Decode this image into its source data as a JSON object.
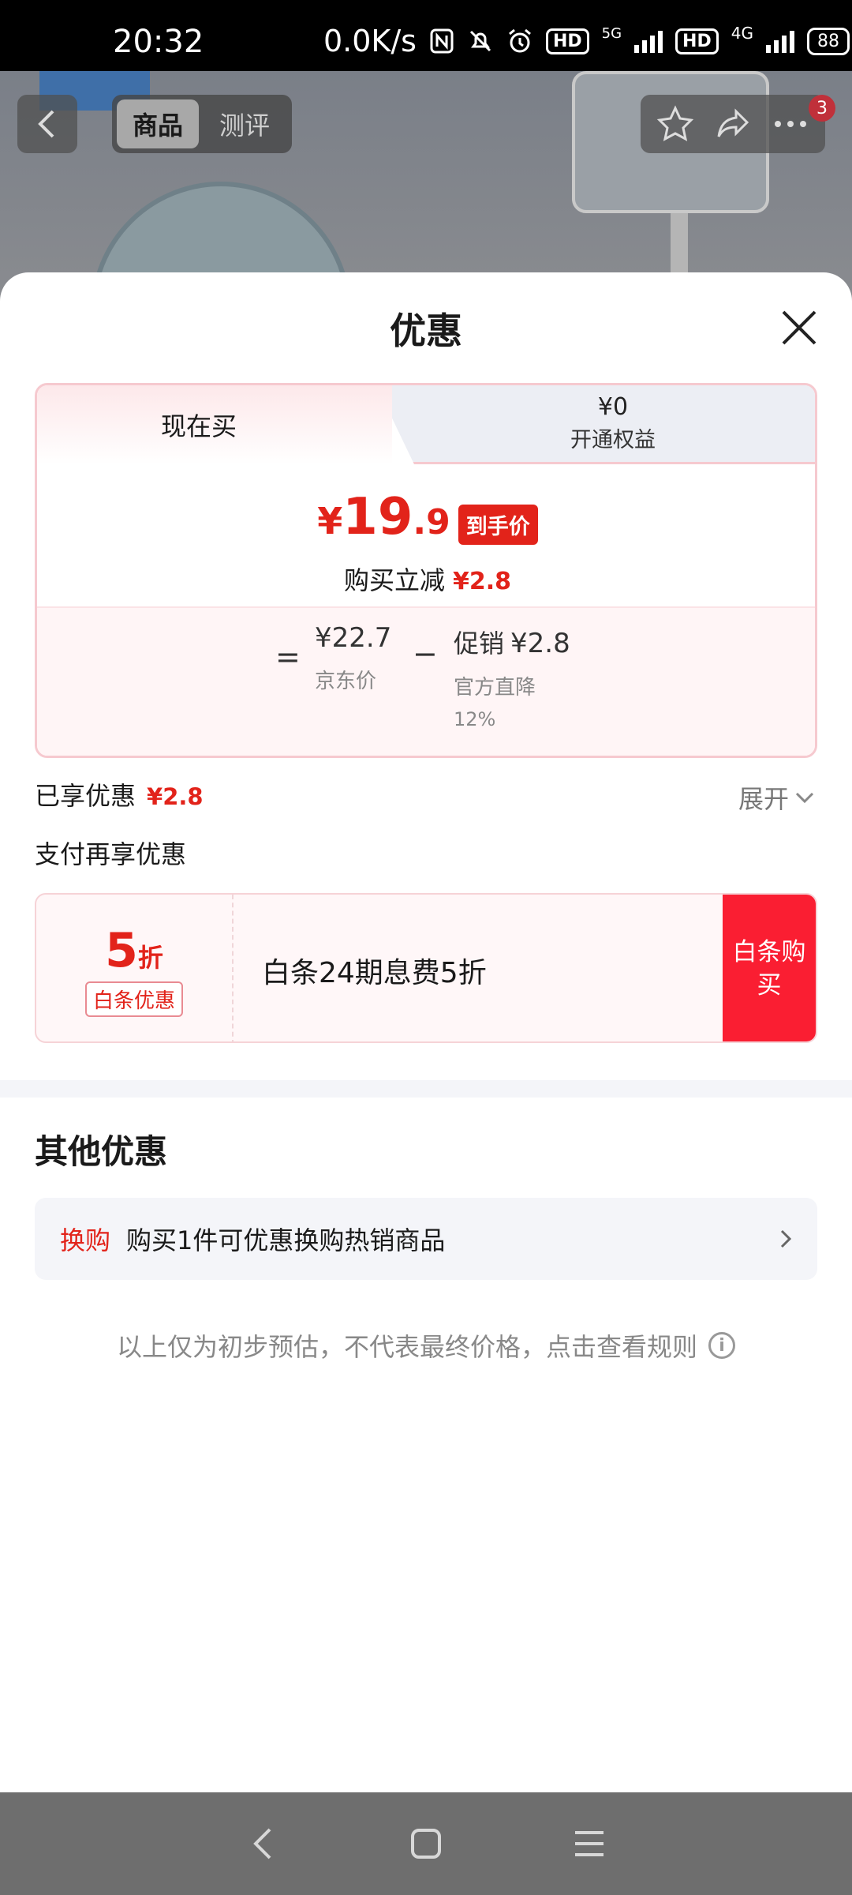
{
  "status_bar": {
    "time": "20:32",
    "net_speed": "0.0K/s",
    "hd1": "HD",
    "gen1": "5G",
    "hd2": "HD",
    "gen2": "4G",
    "battery": "88"
  },
  "header": {
    "tabs": [
      "商品",
      "测评"
    ],
    "badge_count": "3"
  },
  "sheet": {
    "title": "优惠",
    "tab_buy_now": "现在买",
    "tab_member_price": "¥0",
    "tab_member_label": "开通权益",
    "final_price_symbol": "¥",
    "final_price_int": "19",
    "final_price_dec": ".9",
    "final_price_tag": "到手价",
    "instant_off_label": "购买立减",
    "instant_off_amount": "¥2.8",
    "equals": "=",
    "jd_price": "¥22.7",
    "jd_price_label": "京东价",
    "minus": "−",
    "promo_label": "促销",
    "promo_amount": "¥2.8",
    "promo_desc": "官方直降",
    "promo_percent": "12%",
    "enjoyed_label": "已享优惠",
    "enjoyed_amount": "¥2.8",
    "expand_label": "展开",
    "pay_more_label": "支付再享优惠",
    "baitiao": {
      "discount_num": "5",
      "discount_unit": "折",
      "tag": "白条优惠",
      "desc": "白条24期息费5折",
      "button": "白条购买"
    },
    "other_title": "其他优惠",
    "swap_tag": "换购",
    "swap_desc": "购买1件可优惠换购热销商品",
    "disclaimer": "以上仅为初步预估，不代表最终价格，点击查看规则"
  },
  "colors": {
    "accent_red": "#e2231a",
    "button_red": "#fa1e32"
  },
  "icons": [
    "back-icon",
    "star-icon",
    "share-icon",
    "more-icon",
    "close-icon",
    "chevron-down-icon",
    "chevron-right-icon",
    "info-icon",
    "nav-back-icon",
    "nav-home-icon",
    "nav-menu-icon"
  ]
}
